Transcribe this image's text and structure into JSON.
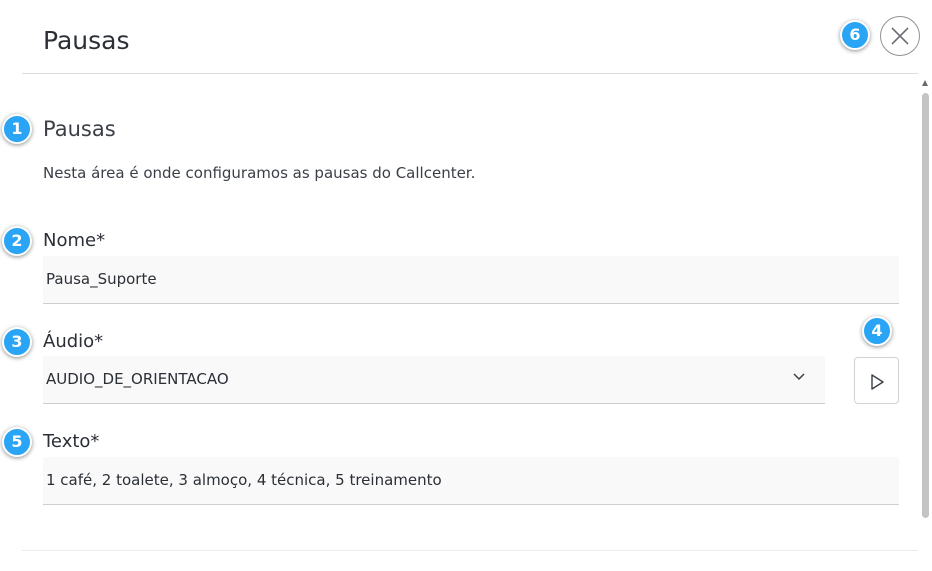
{
  "header": {
    "title": "Pausas",
    "close_icon": "close-icon"
  },
  "section": {
    "title": "Pausas",
    "description": "Nesta área é onde configuramos as pausas do Callcenter."
  },
  "form": {
    "name_label": "Nome*",
    "name_value": "Pausa_Suporte",
    "audio_label": "Áudio*",
    "audio_value": "AUDIO_DE_ORIENTACAO",
    "text_label": "Texto*",
    "text_value": "1 café, 2 toalete, 3 almoço, 4 técnica, 5 treinamento"
  },
  "badges": [
    "1",
    "2",
    "3",
    "4",
    "5",
    "6"
  ],
  "colors": {
    "badge": "#2aa4f4",
    "field_bg": "#f9f9f9",
    "divider": "#dcdcdc"
  },
  "icons": {
    "play": "play-icon",
    "dropdown": "chevron-down-icon",
    "close": "close-icon"
  }
}
